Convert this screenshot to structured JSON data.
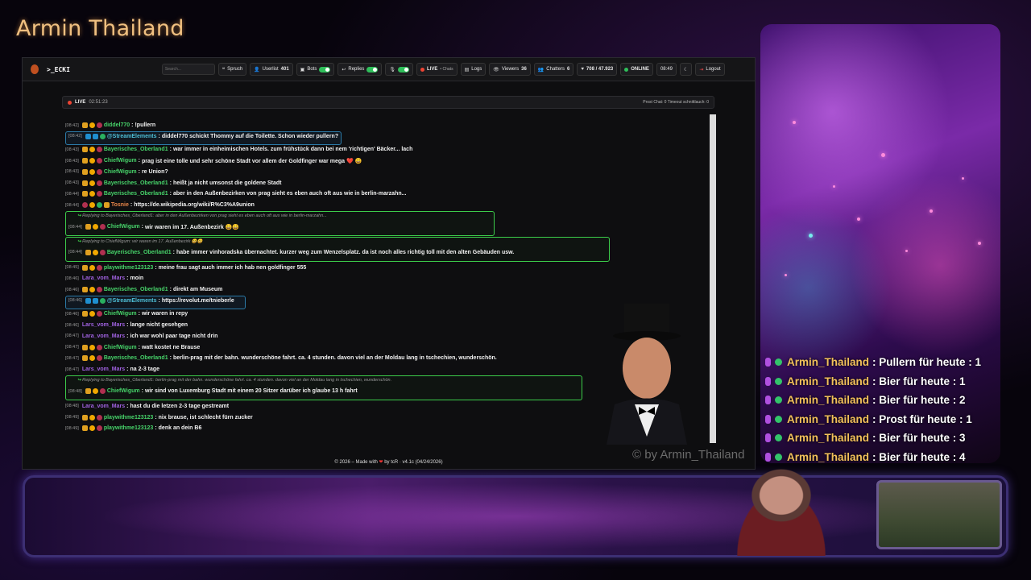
{
  "overlay": {
    "brand": "Armin Thailand",
    "stats": [
      {
        "user": "Armin_Thailand",
        "text": ": Pullern für heute : 1"
      },
      {
        "user": "Armin_Thailand",
        "text": ": Bier für heute : 1"
      },
      {
        "user": "Armin_Thailand",
        "text": ": Bier für heute : 2"
      },
      {
        "user": "Armin_Thailand",
        "text": ": Prost für heute : 1"
      },
      {
        "user": "Armin_Thailand",
        "text": ": Bier für heute : 3"
      },
      {
        "user": "Armin_Thailand",
        "text": ": Bier für heute : 4"
      }
    ],
    "watermark": "© by Armin_Thailand"
  },
  "app": {
    "title": ">_ECKI",
    "search_placeholder": "Search...",
    "toolbar": {
      "spruch": "Spruch",
      "userlist": "Userlist",
      "userlist_count": "401",
      "bots": "Bots",
      "replies": "Replies",
      "live": "LIVE",
      "chats": "• Chats",
      "logs": "Logs",
      "viewers": "Viewers",
      "viewers_count": "36",
      "chatters": "Chatters",
      "chatters_count": "6",
      "followers": "708 / 47.923",
      "online": "ONLINE",
      "clock": "08:49",
      "logout": "Logout"
    },
    "live_bar": {
      "status": "LIVE",
      "uptime": "02:51:23",
      "counters": "Prost Chat: 0  Timeout schnittlauch: 0"
    },
    "footer": {
      "prefix": "© 2026 – Made with",
      "heart": "❤",
      "suffix": "by tcR · v4.1c (04/24/2026)"
    }
  },
  "chat": {
    "messages": [
      {
        "ts": "[08:42]",
        "user": "diddel770",
        "text": "!pullern",
        "color": "green"
      },
      {
        "ts": "[08:42]",
        "user": "@StreamElements",
        "text": "diddel770 schickt Thommy auf die Toilette. Schon wieder pullern?",
        "color": "teal"
      },
      {
        "ts": "[08:43]",
        "user": "Bayerisches_Oberland1",
        "text": "war immer in einheimischen Hotels. zum frühstück dann bei nem 'richtigen' Bäcker... lach",
        "color": "green"
      },
      {
        "ts": "[08:43]",
        "user": "ChiefWigum",
        "text": "prag ist eine tolle und sehr schöne Stadt vor allem der Goldfinger war mega ❤️ 😄",
        "color": "green"
      },
      {
        "ts": "[08:43]",
        "user": "ChiefWigum",
        "text": "re Union?",
        "color": "green"
      },
      {
        "ts": "[08:43]",
        "user": "Bayerisches_Oberland1",
        "text": "heißt ja nicht umsonst die goldene Stadt",
        "color": "green"
      },
      {
        "ts": "[08:44]",
        "user": "Bayerisches_Oberland1",
        "text": "aber in den Außenbezirken von prag sieht es eben auch oft aus wie in berlin-marzahn...",
        "color": "green"
      },
      {
        "ts": "[08:44]",
        "user": "Tosnie",
        "text": "https://de.wikipedia.org/wiki/R%C3%A9union",
        "color": "orange"
      },
      {
        "ts": "[08:44]",
        "user": "ChiefWigum",
        "text": "wir waren im 17. Außenbezirk 😄😄",
        "color": "green",
        "reply": "Replying to Bayerisches_Oberland1: aber in den Außenbezirken von prag sieht es eben auch oft aus wie in berlin-marzahn..."
      },
      {
        "ts": "[08:44]",
        "user": "Bayerisches_Oberland1",
        "text": "habe immer vinhoradska übernachtet. kurzer weg zum Wenzelsplatz. da ist noch alles richtig toll mit den alten Gebäuden usw.",
        "color": "green",
        "reply": "Replying to ChiefWigum: wir waren im 17. Außenbezirk 😄😄"
      },
      {
        "ts": "[08:45]",
        "user": "playwithme123123",
        "text": "meine frau sagt auch immer ich hab nen goldfinger 555",
        "color": "green"
      },
      {
        "ts": "[08:46]",
        "user": "Lara_vom_Mars",
        "text": "moin",
        "color": "purple"
      },
      {
        "ts": "[08:46]",
        "user": "Bayerisches_Oberland1",
        "text": "direkt am Museum",
        "color": "green"
      },
      {
        "ts": "[08:46]",
        "user": "@StreamElements",
        "text": "https://revolut.me/tnieberle",
        "color": "teal"
      },
      {
        "ts": "[08:46]",
        "user": "ChiefWigum",
        "text": "wir waren in repy",
        "color": "green"
      },
      {
        "ts": "[08:46]",
        "user": "Lars_vom_Mars",
        "text": "lange nicht gesehgen",
        "color": "purple"
      },
      {
        "ts": "[08:47]",
        "user": "Lara_vom_Mars",
        "text": "ich war wohl paar tage nicht drin",
        "color": "purple"
      },
      {
        "ts": "[08:47]",
        "user": "ChiefWigum",
        "text": "watt kostet ne Brause",
        "color": "green"
      },
      {
        "ts": "[08:47]",
        "user": "Bayerisches_Oberland1",
        "text": "berlin-prag mit der bahn. wunderschöne fahrt. ca. 4 stunden. davon viel an der Moldau lang in tschechien, wunderschön.",
        "color": "green"
      },
      {
        "ts": "[08:47]",
        "user": "Lars_vom_Mars",
        "text": "na 2-3 tage",
        "color": "purple"
      },
      {
        "ts": "[08:48]",
        "user": "ChiefWigum",
        "text": "wir sind von Luxemburg Stadt mit einem 20 Sitzer darüber ich glaube 13 h fahrt",
        "color": "green",
        "reply": "Replying to Bayerisches_Oberland1: berlin-prag mit der bahn. wunderschöne fahrt. ca. 4 stunden. davon viel an der Moldau lang in tschechien, wunderschön."
      },
      {
        "ts": "[08:48]",
        "user": "Lara_vom_Mars",
        "text": "hast du die letzen 2-3 tage gestreamt",
        "color": "purple"
      },
      {
        "ts": "[08:49]",
        "user": "playwithme123123",
        "text": "nix brause, ist schlecht fürn zucker",
        "color": "green"
      },
      {
        "ts": "[08:49]",
        "user": "playwithme123123",
        "text": "denk an dein B6",
        "color": "green"
      }
    ]
  }
}
